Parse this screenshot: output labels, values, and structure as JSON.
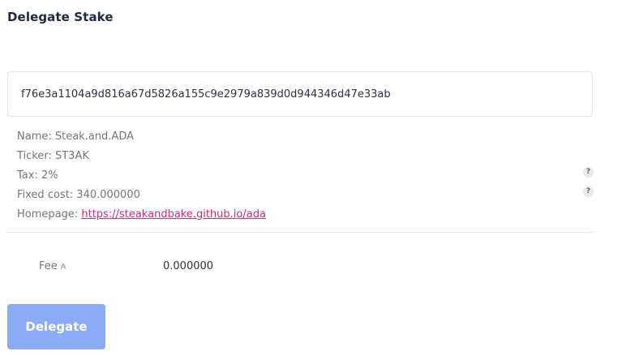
{
  "page": {
    "title": "Delegate Stake"
  },
  "pool_id": {
    "value": "f76e3a1104a9d816a67d5826a155c9e2979a839d0d944346d47e33ab"
  },
  "pool_info": {
    "name": "Name: Steak.and.ADA",
    "ticker": "Ticker: ST3AK",
    "tax": "Tax: 2%",
    "fixed_cost": "Fixed cost: 340.000000",
    "homepage_label": "Homepage: ",
    "homepage_url": "https://steakandbake.github.io/ada"
  },
  "help_icons": {
    "glyph": "?"
  },
  "fee": {
    "label": "Fee",
    "currency_symbol": "₳",
    "value": "0.000000"
  },
  "actions": {
    "delegate_label": "Delegate"
  },
  "colors": {
    "button_bg": "#8aacf6",
    "link": "#d4267a"
  }
}
